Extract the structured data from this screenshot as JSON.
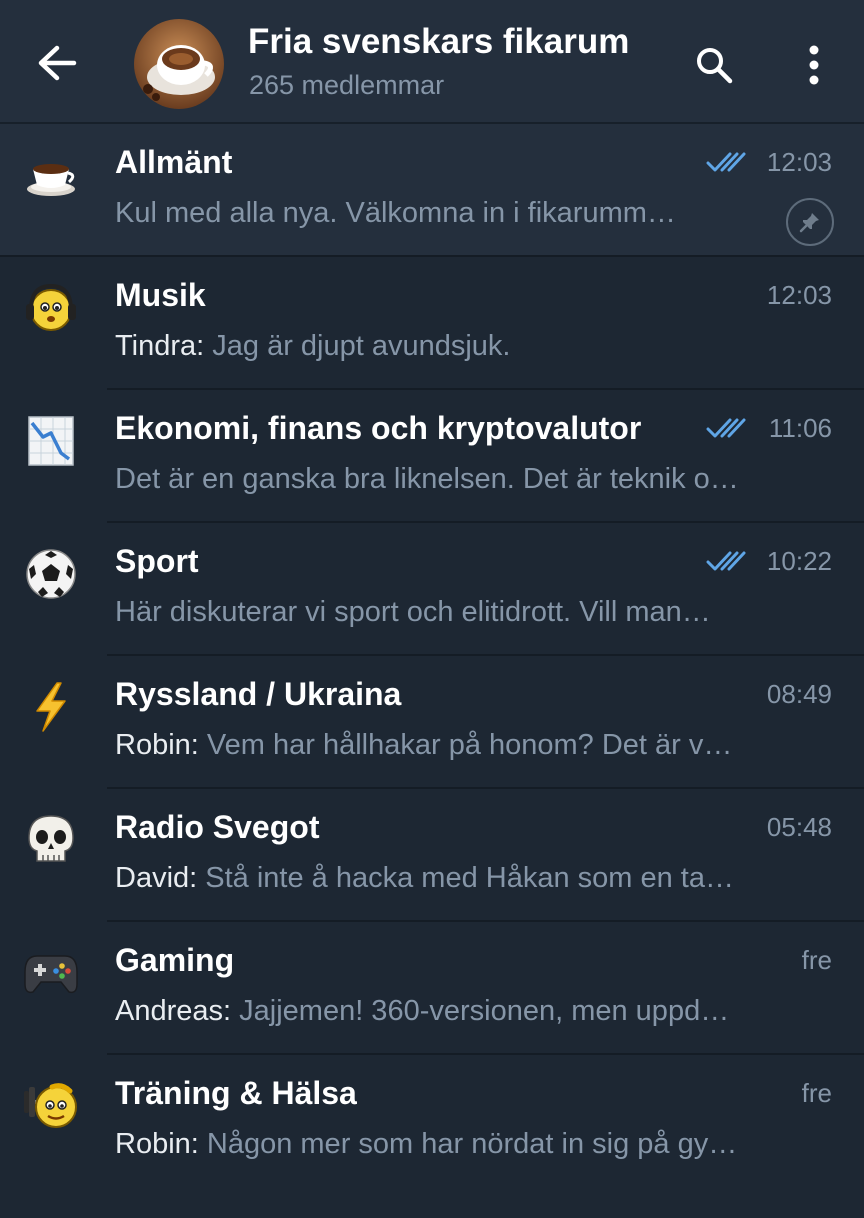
{
  "header": {
    "title": "Fria svenskars fikarum",
    "subtitle": "265 medlemmar",
    "back_icon": "arrow-left-icon",
    "search_icon": "search-icon",
    "menu_icon": "more-vertical-icon",
    "avatar": "coffee-cup-photo"
  },
  "colors": {
    "background": "#1d2733",
    "header_bg": "#242f3d",
    "pinned_bg": "#242f3d",
    "secondary_text": "#8696a8",
    "check_blue": "#5fa5e6"
  },
  "topics": [
    {
      "name": "Allmänt",
      "time": "12:03",
      "sender": "",
      "message": "Kul med alla nya. Välkomna in i fikarumm…",
      "read_checks": true,
      "pinned": true,
      "icon": "coffee-cup-icon"
    },
    {
      "name": "Musik",
      "time": "12:03",
      "sender": "Tindra: ",
      "message": "Jag är djupt avundsjuk.",
      "read_checks": false,
      "pinned": false,
      "icon": "headphones-smiley-icon"
    },
    {
      "name": "Ekonomi, finans och kryptovalutor",
      "time": "11:06",
      "sender": "",
      "message": "Det är en ganska bra liknelsen. Det är teknik o…",
      "read_checks": true,
      "pinned": false,
      "icon": "chart-decreasing-icon"
    },
    {
      "name": "Sport",
      "time": "10:22",
      "sender": "",
      "message": "Här diskuterar vi sport och elitidrott. Vill man…",
      "read_checks": true,
      "pinned": false,
      "icon": "soccer-ball-icon"
    },
    {
      "name": "Ryssland / Ukraina",
      "time": "08:49",
      "sender": "Robin: ",
      "message": "Vem har hållhakar på honom? Det är v…",
      "read_checks": false,
      "pinned": false,
      "icon": "lightning-icon"
    },
    {
      "name": "Radio Svegot",
      "time": "05:48",
      "sender": "David: ",
      "message": "Stå inte å hacka med Håkan som en ta…",
      "read_checks": false,
      "pinned": false,
      "icon": "skull-icon"
    },
    {
      "name": "Gaming",
      "time": "fre",
      "sender": "Andreas: ",
      "message": "Jajjemen! 360-versionen, men uppd…",
      "read_checks": false,
      "pinned": false,
      "icon": "gamepad-icon"
    },
    {
      "name": "Träning & Hälsa",
      "time": "fre",
      "sender": "Robin: ",
      "message": "Någon mer som har nördat in sig på gy…",
      "read_checks": false,
      "pinned": false,
      "icon": "weightlifting-smiley-icon"
    }
  ]
}
